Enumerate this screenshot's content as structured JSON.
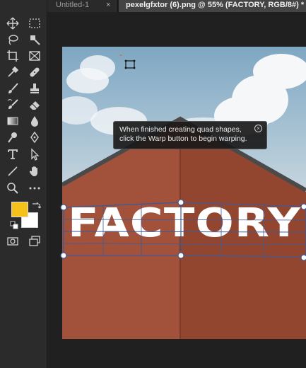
{
  "tabs": [
    {
      "label": "Untitled-1",
      "close": "×"
    },
    {
      "label": "pexelgfxtor (6).png @ 55% (FACTORY, RGB/8#) *",
      "close": "×"
    }
  ],
  "tooltip": {
    "line1": "When finished creating quad shapes,",
    "line2": "click the Warp button to begin warping.",
    "close": "⊗"
  },
  "canvas_text": "FACTORY",
  "colors": {
    "foreground": "#f6c11a",
    "background": "#ffffff",
    "wall": "#a2523a",
    "wall_dark": "#93462f",
    "roof": "#4a4a4a",
    "grid": "#3f5a97"
  },
  "tools": [
    "move-icon",
    "marquee-icon",
    "lasso-icon",
    "quick-select-icon",
    "crop-icon",
    "frame-icon",
    "eyedropper-icon",
    "healing-icon",
    "brush-icon",
    "stamp-icon",
    "history-brush-icon",
    "eraser-icon",
    "gradient-icon",
    "blur-icon",
    "dodge-icon",
    "pen-icon",
    "type-icon",
    "path-select-icon",
    "line-icon",
    "hand-icon",
    "zoom-icon",
    "more-icon"
  ]
}
